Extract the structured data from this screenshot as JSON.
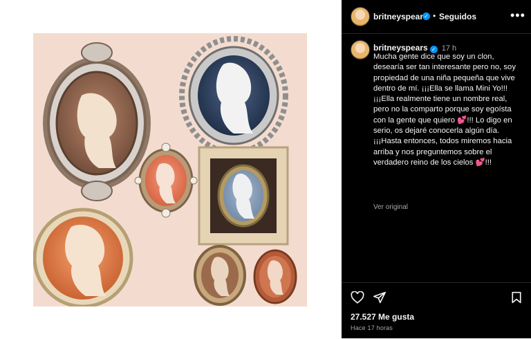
{
  "post": {
    "username": "britneyspears",
    "follow_status": "Seguidos",
    "separator": "•",
    "more_icon": "more-horizontal-icon"
  },
  "caption": {
    "username": "britneyspears",
    "time_ago": "17 h",
    "line_1": "Mucha gente dice que soy un clon, desearía ser tan interesante pero no, soy propiedad de una niña pequeña que vive dentro de mí. ¡¡¡Ella se llama Mini Yo!!! ¡¡¡Ella realmente tiene un nombre real, pero no la comparto porque soy egoísta con la gente que quiero ",
    "heart_1": "💕",
    "line_2": "!!! Lo digo en serio, os dejaré conocerla algún día. ¡¡¡Hasta entonces, todos miremos hacia arriba y nos preguntemos sobre el verdadero reino de los cielos ",
    "heart_2": "💕",
    "line_3": "!!!",
    "see_translation": "Ver original"
  },
  "actions": {
    "like_icon": "heart-outline-icon",
    "share_icon": "paper-plane-icon",
    "save_icon": "bookmark-icon",
    "likes_count": "27.527 Me gusta",
    "posted_ago": "Hace 17 horas"
  },
  "colors": {
    "panel_bg": "#000000",
    "verified_blue": "#0095f6",
    "photo_bg": "#f3dccf"
  }
}
